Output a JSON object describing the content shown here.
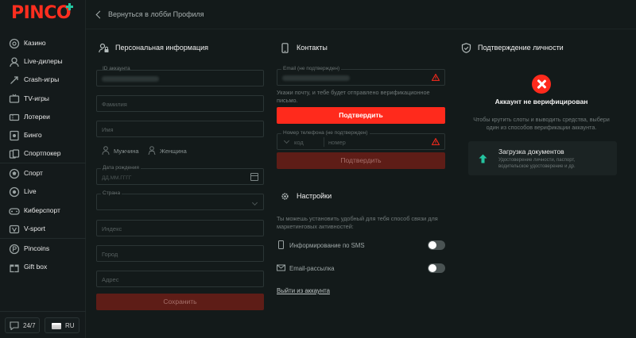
{
  "brand": {
    "logo_text": "PINCO",
    "accent": "#ff2a1c",
    "logo_plus_color": "#25c4a0"
  },
  "sidebar": {
    "items": [
      {
        "label": "Казино",
        "icon": "casino-chip-icon"
      },
      {
        "label": "Live-дилеры",
        "icon": "live-dealer-icon"
      },
      {
        "label": "Crash-игры",
        "icon": "rocket-icon"
      },
      {
        "label": "TV-игры",
        "icon": "tv-icon"
      },
      {
        "label": "Лотереи",
        "icon": "lottery-ticket-icon"
      },
      {
        "label": "Бинго",
        "icon": "bingo-icon"
      },
      {
        "label": "Спортпокер",
        "icon": "cards-icon"
      },
      {
        "label": "Спорт",
        "icon": "ball-icon"
      },
      {
        "label": "Live",
        "icon": "live-icon"
      },
      {
        "label": "Киберспорт",
        "icon": "gamepad-icon"
      },
      {
        "label": "V-sport",
        "icon": "v-sport-icon"
      },
      {
        "label": "Pincoins",
        "icon": "coin-icon"
      },
      {
        "label": "Gift box",
        "icon": "gift-icon"
      }
    ],
    "support_label": "24/7",
    "language_label": "RU"
  },
  "header": {
    "back_label": "Вернуться в лобби Профиля"
  },
  "personal": {
    "title": "Персональная информация",
    "account_id_label": "ID аккаунта",
    "surname_placeholder": "Фамилия",
    "name_placeholder": "Имя",
    "gender_male": "Мужчина",
    "gender_female": "Женщина",
    "birthdate_label": "Дата рождения",
    "birthdate_placeholder": "ДД.ММ.ГГГГ",
    "country_label": "Страна",
    "index_placeholder": "Индекс",
    "city_placeholder": "Город",
    "address_placeholder": "Адрес",
    "save_button": "Сохранить"
  },
  "contacts": {
    "title": "Контакты",
    "email_label": "Email (не подтвержден)",
    "email_note": "Укажи почту, и тебе будет отправлено верификационное письмо.",
    "confirm_button": "Подтвердить",
    "phone_label": "Номер телефона (не подтвержден)",
    "phone_code_placeholder": "код",
    "phone_number_placeholder": "номер",
    "confirm_phone_button": "Подтвердить"
  },
  "settings": {
    "title": "Настройки",
    "note": "Ты можешь установить удобный для тебя способ связи для маркетинговых активностей:",
    "sms_label": "Информирование по SMS",
    "email_label": "Email-рассылка",
    "logout_label": "Выйти из аккаунта"
  },
  "verification": {
    "title": "Подтверждение личности",
    "status": "Аккаунт не верифицирован",
    "note": "Чтобы крутить слоты и выводить средства, выбери один из способов верификации аккаунта.",
    "upload_title": "Загрузка документов",
    "upload_desc": "Удостоверение личности, паспорт, водительское удостоверение и др."
  }
}
